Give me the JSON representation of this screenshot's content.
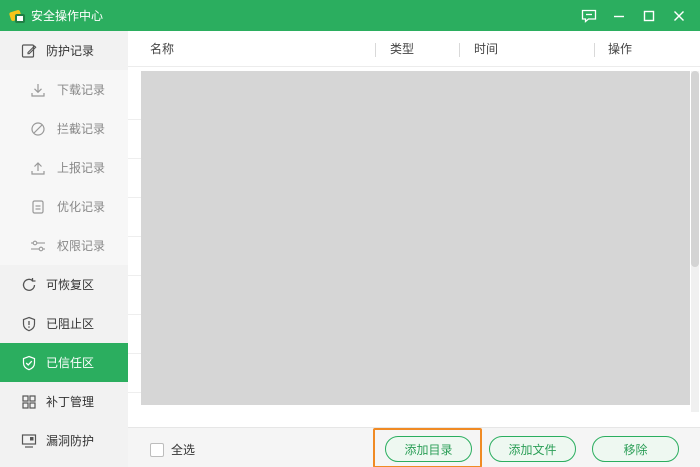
{
  "app": {
    "title": "安全操作中心"
  },
  "theme": {
    "accent": "#2bae5f",
    "highlight": "#f08a24"
  },
  "window_controls": [
    {
      "name": "feedback-icon"
    },
    {
      "name": "minimize-icon"
    },
    {
      "name": "maximize-icon"
    },
    {
      "name": "close-icon"
    }
  ],
  "sidebar": {
    "items": [
      {
        "label": "防护记录",
        "icon": "edit-icon"
      },
      {
        "label": "下载记录",
        "icon": "download-icon"
      },
      {
        "label": "拦截记录",
        "icon": "block-icon"
      },
      {
        "label": "上报记录",
        "icon": "upload-icon"
      },
      {
        "label": "优化记录",
        "icon": "document-icon"
      },
      {
        "label": "权限记录",
        "icon": "sliders-icon"
      },
      {
        "label": "可恢复区",
        "icon": "refresh-icon"
      },
      {
        "label": "已阻止区",
        "icon": "shield-alert-icon"
      },
      {
        "label": "已信任区",
        "icon": "shield-check-icon"
      },
      {
        "label": "补丁管理",
        "icon": "grid-icon"
      },
      {
        "label": "漏洞防护",
        "icon": "monitor-icon"
      }
    ]
  },
  "table": {
    "columns": [
      "名称",
      "类型",
      "时间",
      "操作"
    ]
  },
  "footer": {
    "select_all_label": "全选",
    "add_folder_label": "添加目录",
    "add_file_label": "添加文件",
    "remove_label": "移除"
  }
}
